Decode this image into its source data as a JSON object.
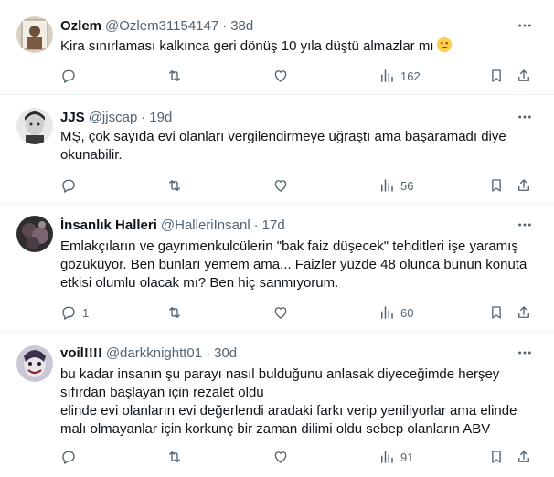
{
  "tweets": [
    {
      "name": "Ozlem",
      "handle": "@Ozlem31154147",
      "dot": "·",
      "time": "38d",
      "lines": [
        "Kira sınırlaması kalkınca geri dönüş 10 yıla düştü almazlar mı"
      ],
      "emoji": "confused-face",
      "replies": "",
      "retweets": "",
      "likes": "",
      "views": "162",
      "avatar_colors": [
        "#d9d2c4",
        "#6b4f3a"
      ]
    },
    {
      "name": "JJS",
      "handle": "@jjscap",
      "dot": "·",
      "time": "19d",
      "lines": [
        "MŞ, çok sayıda evi olanları vergilendirmeye uğraştı ama başaramadı diye",
        "okunabilir."
      ],
      "replies": "",
      "retweets": "",
      "likes": "",
      "views": "56",
      "avatar_colors": [
        "#d0d0d0",
        "#2a2a2a"
      ]
    },
    {
      "name": "İnsanlık Halleri",
      "handle": "@HalleriInsanl",
      "dot": "·",
      "time": "17d",
      "lines": [
        "Emlakçıların ve gayrımenkulcülerin \"bak faiz düşecek\" tehditleri işe yaramış",
        "gözüküyor. Ben bunları yemem ama... Faizler yüzde 48 olunca bunun konuta",
        "etkisi olumlu olacak mı? Ben hiç sanmıyorum."
      ],
      "replies": "1",
      "retweets": "",
      "likes": "",
      "views": "60",
      "avatar_colors": [
        "#3a3a3a",
        "#8a6a7a"
      ]
    },
    {
      "name": "voil!!!!",
      "handle": "@darkknightt01",
      "dot": "·",
      "time": "30d",
      "lines": [
        "bu kadar insanın şu parayı nasıl bulduğunu anlasak diyeceğimde herşey",
        "sıfırdan başlayan için rezalet oldu",
        "elinde evi olanların evi değerlendi aradaki farkı verip yeniliyorlar ama elinde",
        "malı olmayanlar için korkunç bir zaman dilimi oldu sebep olanların ABV"
      ],
      "replies": "",
      "retweets": "",
      "likes": "",
      "views": "91",
      "avatar_colors": [
        "#c9c9d6",
        "#3b2f4a"
      ]
    }
  ]
}
